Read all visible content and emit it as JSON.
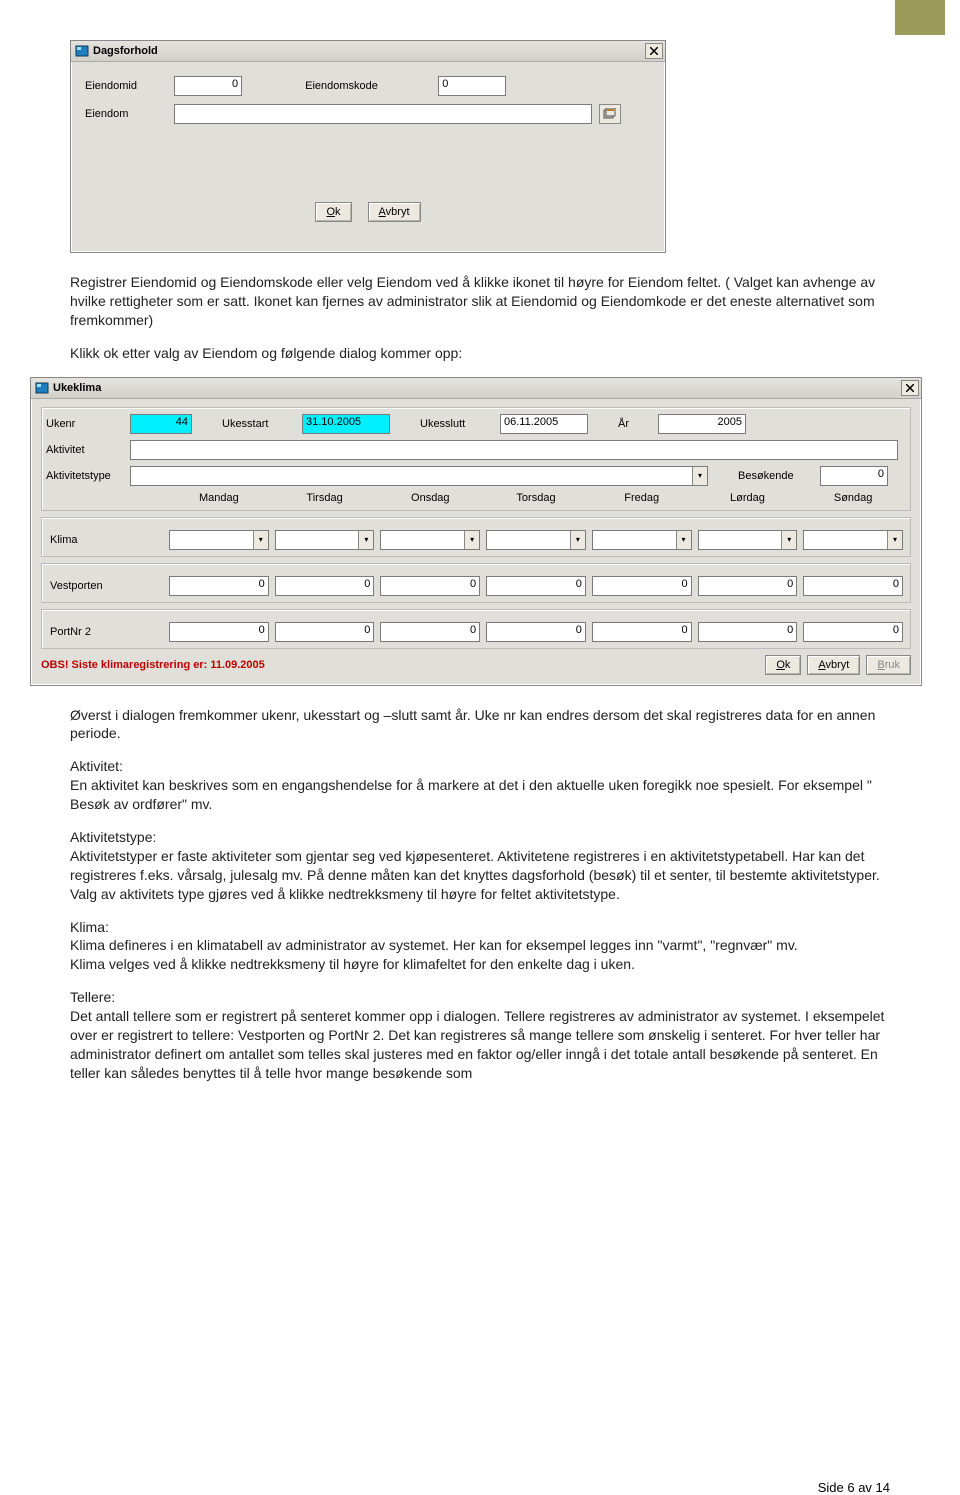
{
  "dialog1": {
    "title": "Dagsforhold",
    "labels": {
      "eiendomid": "Eiendomid",
      "eiendomskode": "Eiendomskode",
      "eiendom": "Eiendom"
    },
    "values": {
      "eiendomid": "0",
      "eiendomskode": "0",
      "eiendom": ""
    },
    "buttons": {
      "ok": "Ok",
      "avbryt": "Avbryt"
    }
  },
  "para1": "Registrer Eiendomid og Eiendomskode eller velg Eiendom ved å klikke ikonet til høyre for Eiendom feltet. ( Valget kan avhenge av hvilke rettigheter som er satt. Ikonet kan fjernes av administrator slik at Eiendomid og Eiendomkode er det eneste alternativet som fremkommer)",
  "para2": "Klikk ok etter valg av Eiendom og følgende dialog kommer opp:",
  "dialog2": {
    "title": "Ukeklima",
    "labels": {
      "ukenr": "Ukenr",
      "ukesstart": "Ukesstart",
      "ukesslutt": "Ukesslutt",
      "ar": "År",
      "aktivitet": "Aktivitet",
      "aktivitetstype": "Aktivitetstype",
      "besokende": "Besøkende",
      "klima": "Klima",
      "vestporten": "Vestporten",
      "portnr2": "PortNr 2"
    },
    "values": {
      "ukenr": "44",
      "ukesstart": "31.10.2005",
      "ukesslutt": "06.11.2005",
      "ar": "2005",
      "aktivitet": "",
      "aktivitetstype": "",
      "besokende": "0",
      "vestporten": [
        "0",
        "0",
        "0",
        "0",
        "0",
        "0",
        "0"
      ],
      "portnr2": [
        "0",
        "0",
        "0",
        "0",
        "0",
        "0",
        "0"
      ]
    },
    "days": [
      "Mandag",
      "Tirsdag",
      "Onsdag",
      "Torsdag",
      "Fredag",
      "Lørdag",
      "Søndag"
    ],
    "obs": "OBS! Siste klimaregistrering er: 11.09.2005",
    "buttons": {
      "ok": "Ok",
      "avbryt": "Avbryt",
      "bruk": "Bruk"
    }
  },
  "body_after": {
    "p1": "Øverst i dialogen fremkommer ukenr, ukesstart og –slutt samt år. Uke nr kan endres dersom det skal registreres data for en annen periode.",
    "h_akt": "Aktivitet:",
    "p_akt": "En aktivitet kan beskrives som en engangshendelse for å markere at det i den aktuelle uken foregikk noe spesielt. For eksempel \" Besøk av ordfører\" mv.",
    "h_at": "Aktivitetstype:",
    "p_at": "Aktivitetstyper er faste aktiviteter som gjentar seg ved kjøpesenteret. Aktivitetene registreres i en aktivitetstypetabell. Har kan det registreres f.eks. vårsalg, julesalg mv. På denne måten kan det knyttes dagsforhold (besøk) til et senter, til bestemte aktivitetstyper. Valg av aktivitets type gjøres ved å klikke nedtrekksmeny til høyre for feltet aktivitetstype.",
    "h_kl": "Klima:",
    "p_kl1": "Klima defineres i en klimatabell av administrator av systemet. Her kan for eksempel legges inn \"varmt\", \"regnvær\" mv.",
    "p_kl2": "Klima velges ved å klikke nedtrekksmeny til høyre for klimafeltet for den enkelte dag i uken.",
    "h_te": "Tellere:",
    "p_te": "Det antall tellere som er registrert på senteret kommer opp i dialogen. Tellere registreres av administrator av systemet. I eksempelet over er registrert to tellere: Vestporten og PortNr 2. Det kan registreres så mange tellere som ønskelig i senteret. For hver teller har administrator definert om antallet som telles skal justeres med en faktor og/eller inngå i det totale antall besøkende på senteret.  En teller kan således benyttes til å telle hvor mange besøkende som"
  },
  "footer": "Side 6 av 14"
}
